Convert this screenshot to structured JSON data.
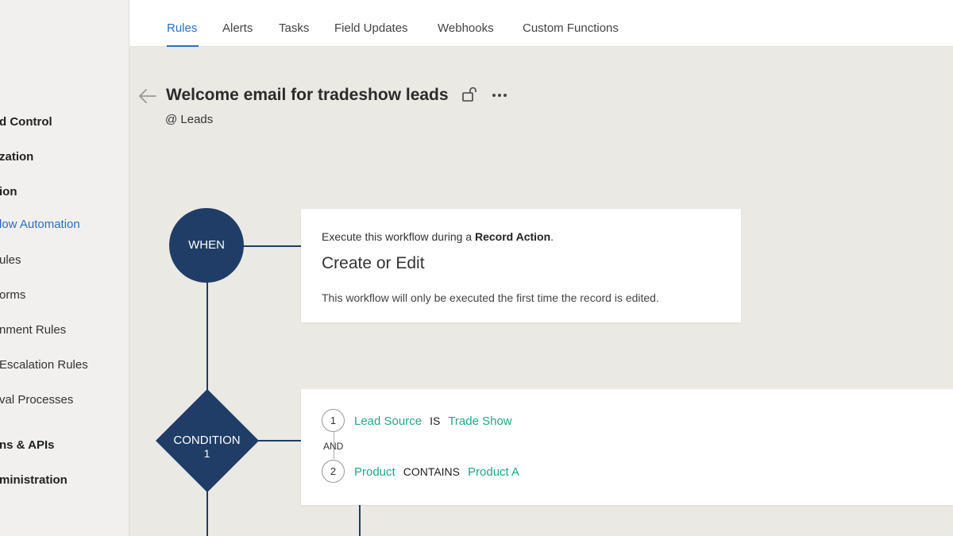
{
  "sidebar": {
    "items": [
      {
        "label": "d Control",
        "style": "bold"
      },
      {
        "label": "zation",
        "style": "bold"
      },
      {
        "label": "ion",
        "style": "bold"
      },
      {
        "label": "low Automation",
        "style": "active"
      },
      {
        "label": "ules",
        "style": "normal"
      },
      {
        "label": "orms",
        "style": "normal"
      },
      {
        "label": "nment Rules",
        "style": "normal"
      },
      {
        "label": "Escalation Rules",
        "style": "normal"
      },
      {
        "label": "val Processes",
        "style": "normal"
      },
      {
        "label": "ns & APIs",
        "style": "bold"
      },
      {
        "label": "ministration",
        "style": "bold"
      }
    ]
  },
  "tabs": [
    {
      "label": "Rules",
      "active": true
    },
    {
      "label": "Alerts",
      "active": false
    },
    {
      "label": "Tasks",
      "active": false
    },
    {
      "label": "Field Updates",
      "active": false
    },
    {
      "label": "Webhooks",
      "active": false
    },
    {
      "label": "Custom Functions",
      "active": false
    }
  ],
  "header": {
    "title": "Welcome email for tradeshow leads",
    "module": "@ Leads",
    "icons": {
      "back": "arrow-left-icon",
      "lock": "unlock-icon",
      "more": "more-horizontal-icon"
    }
  },
  "flow": {
    "when_node": {
      "label": "WHEN"
    },
    "condition_node": {
      "label_line1": "CONDITION",
      "label_line2": "1"
    },
    "when_card": {
      "line_prefix": "Execute this workflow during a ",
      "line_bold": "Record Action",
      "line_suffix": ".",
      "action": "Create or Edit",
      "note": "This workflow will only be executed the first time the record is edited."
    },
    "condition_card": {
      "conditions": [
        {
          "number": "1",
          "field": "Lead Source",
          "operator": "IS",
          "value": "Trade Show"
        },
        {
          "number": "2",
          "field": "Product",
          "operator": "CONTAINS",
          "value": "Product A"
        }
      ],
      "connector": "AND"
    }
  },
  "colors": {
    "accent": "#2a6fc0",
    "node_fill": "#1f3d66",
    "condition_link": "#1ea88a",
    "canvas": "#ebe9e4"
  }
}
